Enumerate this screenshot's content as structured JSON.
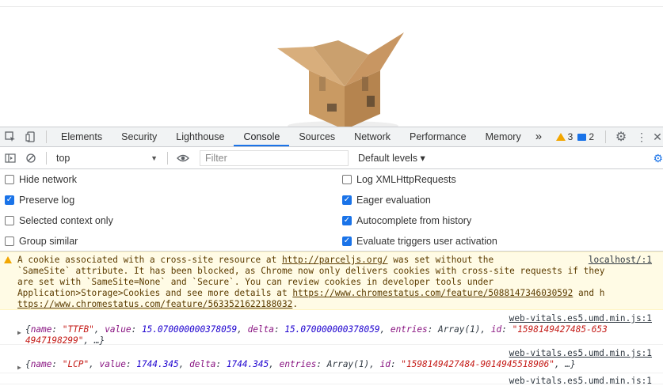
{
  "tabs": [
    "Elements",
    "Security",
    "Lighthouse",
    "Console",
    "Sources",
    "Network",
    "Performance",
    "Memory"
  ],
  "active_tab": "Console",
  "more_tabs": "»",
  "warning_count": "3",
  "message_count": "2",
  "toolbar": {
    "context": "top",
    "filter_placeholder": "Filter",
    "levels": "Default levels ▾"
  },
  "settings": {
    "left": [
      {
        "label": "Hide network",
        "checked": false
      },
      {
        "label": "Preserve log",
        "checked": true
      },
      {
        "label": "Selected context only",
        "checked": false
      },
      {
        "label": "Group similar",
        "checked": false
      }
    ],
    "right": [
      {
        "label": "Log XMLHttpRequests",
        "checked": false
      },
      {
        "label": "Eager evaluation",
        "checked": true
      },
      {
        "label": "Autocomplete from history",
        "checked": true
      },
      {
        "label": "Evaluate triggers user activation",
        "checked": true
      }
    ]
  },
  "warning": {
    "line1_a": "A cookie associated with a cross-site resource at ",
    "link1": "http://parceljs.org/",
    "line1_b": " was set without the",
    "source": "localhost/:1",
    "line2": "`SameSite` attribute. It has been blocked, as Chrome now only delivers cookies with cross-site requests if they",
    "line3": "are set with `SameSite=None` and `Secure`. You can review cookies in developer tools under",
    "line4_a": "Application>Storage>Cookies and see more details at ",
    "link2": "https://www.chromestatus.com/feature/5088147346030592",
    "line4_b": " and h",
    "line5_link": "ttps://www.chromestatus.com/feature/5633521622188032",
    "line5_end": "."
  },
  "logs": [
    {
      "source": "web-vitals.es5.umd.min.js:1",
      "name": "\"TTFB\"",
      "value": "15.070000000378059",
      "delta": "15.070000000378059",
      "entries": "Array(1)",
      "id_a": "\"1598149427485-653",
      "id_b": "4947198299\"",
      "tail": ", …}"
    },
    {
      "source": "web-vitals.es5.umd.min.js:1",
      "name": "\"LCP\"",
      "value": "1744.345",
      "delta": "1744.345",
      "entries": "Array(1)",
      "id": "\"1598149427484-9014945518906\"",
      "tail": ", …}"
    }
  ],
  "partial_source": "web-vitals.es5.umd.min.js:1"
}
